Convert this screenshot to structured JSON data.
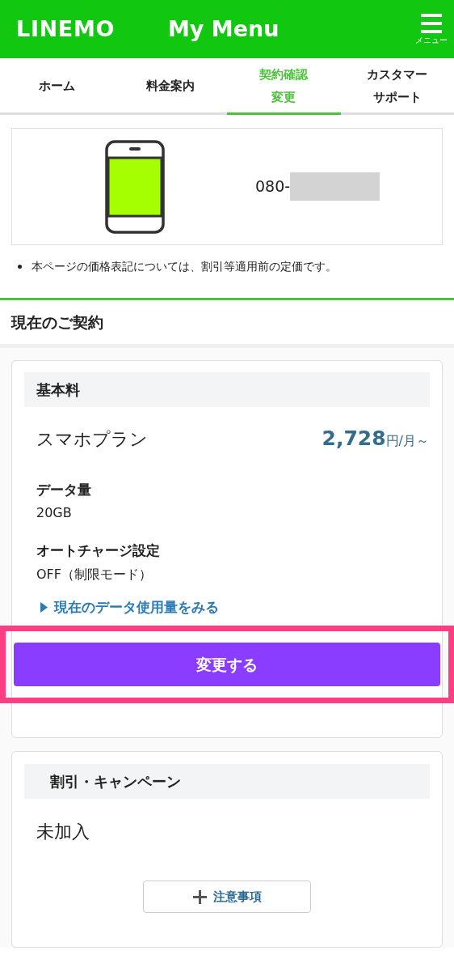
{
  "header": {
    "logo": "LINEMO",
    "title": "My Menu",
    "menu_label": "メニュー"
  },
  "tabs": [
    {
      "lines": [
        "ホーム"
      ],
      "selected": false
    },
    {
      "lines": [
        "料金案内"
      ],
      "selected": false
    },
    {
      "lines": [
        "契約確認",
        "変更"
      ],
      "selected": true
    },
    {
      "lines": [
        "カスタマー",
        "サポート"
      ],
      "selected": false
    }
  ],
  "device": {
    "phone_number": "080-",
    "redacted": true
  },
  "note": "本ページの価格表記については、割引等適用前の定価です。",
  "section_title": "現在のご契約",
  "plan_card": {
    "heading": "基本料",
    "plan_name": "スマホプラン",
    "price": "2,728",
    "price_unit": "円/月～",
    "details": [
      {
        "label": "データ量",
        "value": "20GB"
      },
      {
        "label": "オートチャージ設定",
        "value": "OFF（制限モード）"
      }
    ],
    "link": "現在のデータ使用量をみる",
    "button": {
      "label": "変更する",
      "highlighted": true
    }
  },
  "discount_card": {
    "heading": "割引・キャンペーン",
    "status": "未加入",
    "notes_button": "注意事項"
  }
}
